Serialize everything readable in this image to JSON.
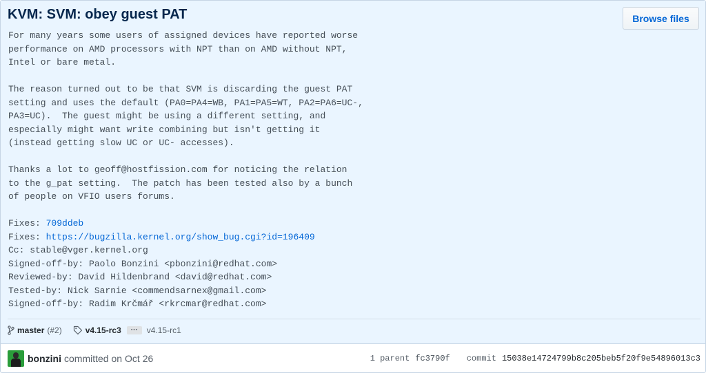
{
  "commit": {
    "title": "KVM: SVM: obey guest PAT",
    "browse_label": "Browse files",
    "description": [
      {
        "text": "For many years some users of assigned devices have reported worse"
      },
      {
        "text": "performance on AMD processors with NPT than on AMD without NPT,"
      },
      {
        "text": "Intel or bare metal."
      },
      {
        "text": ""
      },
      {
        "text": "The reason turned out to be that SVM is discarding the guest PAT"
      },
      {
        "text": "setting and uses the default (PA0=PA4=WB, PA1=PA5=WT, PA2=PA6=UC-,"
      },
      {
        "text": "PA3=UC).  The guest might be using a different setting, and"
      },
      {
        "text": "especially might want write combining but isn't getting it"
      },
      {
        "text": "(instead getting slow UC or UC- accesses)."
      },
      {
        "text": ""
      },
      {
        "text": "Thanks a lot to geoff@hostfission.com for noticing the relation"
      },
      {
        "text": "to the g_pat setting.  The patch has been tested also by a bunch"
      },
      {
        "text": "of people on VFIO users forums."
      },
      {
        "text": ""
      },
      {
        "prefix": "Fixes: ",
        "link": "709ddeb"
      },
      {
        "prefix": "Fixes: ",
        "link": "https://bugzilla.kernel.org/show_bug.cgi?id=196409"
      },
      {
        "text": "Cc: stable@vger.kernel.org"
      },
      {
        "text": "Signed-off-by: Paolo Bonzini <pbonzini@redhat.com>"
      },
      {
        "text": "Reviewed-by: David Hildenbrand <david@redhat.com>"
      },
      {
        "text": "Tested-by: Nick Sarnie <commendsarnex@gmail.com>"
      },
      {
        "text": "Signed-off-by: Radim Krčmář <rkrcmar@redhat.com>"
      }
    ],
    "branch": {
      "name": "master",
      "count": "(#2)"
    },
    "tags": {
      "first": "v4.15-rc3",
      "ellipsis": "···",
      "last": "v4.15-rc1"
    },
    "author": "bonzini",
    "committed_text": "committed on",
    "date": "Oct 26",
    "parent_label": "1 parent",
    "parent_sha": "fc3790f",
    "commit_label": "commit",
    "commit_sha": "15038e14724799b8c205beb5f20f9e54896013c3"
  },
  "colors": {
    "header_bg": "#eaf5ff",
    "title": "#05264c",
    "link": "#0366d6",
    "border": "#c6d5e5"
  },
  "icons": {
    "branch": "git-branch-icon",
    "tag": "tag-icon",
    "avatar": "user-avatar"
  }
}
